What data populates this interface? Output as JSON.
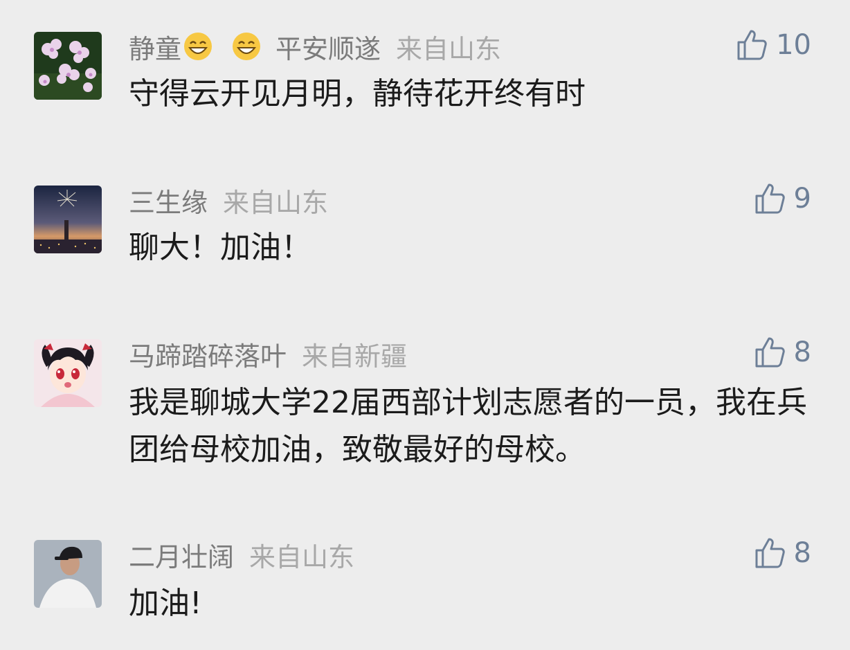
{
  "comments": [
    {
      "name": "静童",
      "name_suffix": "平安顺遂",
      "location": "来自山东",
      "likes": "10",
      "text": "守得云开见月明，静待花开终有时",
      "avatar_icon": "flowers-avatar",
      "emoji_icons": [
        "grinning-face-icon",
        "grinning-face-icon"
      ]
    },
    {
      "name": "三生缘",
      "location": "来自山东",
      "likes": "9",
      "text": "聊大！加油！",
      "avatar_icon": "night-city-fireworks-avatar"
    },
    {
      "name": "马蹄踏碎落叶",
      "location": "来自新疆",
      "likes": "8",
      "text": "我是聊城大学22届西部计划志愿者的一员，我在兵团给母校加油，致敬最好的母校。",
      "avatar_icon": "anime-girl-avatar"
    },
    {
      "name": "二月壮阔",
      "location": "来自山东",
      "likes": "8",
      "text": "加油!",
      "avatar_icon": "person-cap-avatar"
    }
  ],
  "colors": {
    "background": "#ededed",
    "name": "#7b7b7b",
    "location": "#a8a8a8",
    "like": "#6d7f97",
    "text": "#1b1b1b"
  }
}
